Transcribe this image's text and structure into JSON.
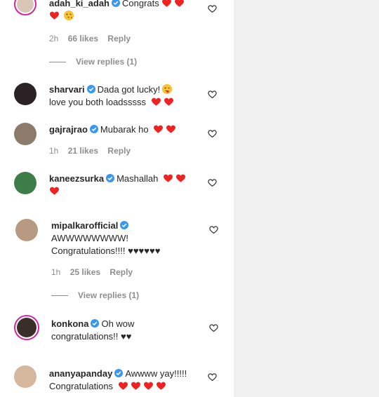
{
  "comments": [
    {
      "user": "adah_ki_adah",
      "text": "Congrats",
      "emoji_after": "♥♥♥😘",
      "time": "2h",
      "likes": "66 likes",
      "reply": "Reply",
      "view_replies": "View replies (1)"
    },
    {
      "user": "sharvari",
      "text": "Dada got lucky!",
      "text2": "love you both loadsssss"
    },
    {
      "user": "gajrajrao",
      "text": "Mubarak ho",
      "time": "1h",
      "likes": "21 likes",
      "reply": "Reply"
    },
    {
      "user": "kaneezsurka",
      "text": "Mashallah"
    },
    {
      "user": "mipalkarofficial",
      "text": "AWWWWWWWW!",
      "text2": "Congratulations!!!! ♥♥♥♥♥♥",
      "time": "1h",
      "likes": "25 likes",
      "reply": "Reply",
      "view_replies": "View replies (1)"
    },
    {
      "user": "konkona",
      "text": "Oh wow",
      "text2": "congratulations!! ♥♥"
    },
    {
      "user": "ananyapanday",
      "text": "Awwww yay!!!!!",
      "text2": "Congratulations"
    }
  ],
  "colors": {
    "heart": "#ed2222",
    "verified": "#3897f0",
    "ring": "#d6249f"
  },
  "icons": {
    "like": "heart-outline-icon",
    "verified": "verified-badge-icon"
  }
}
